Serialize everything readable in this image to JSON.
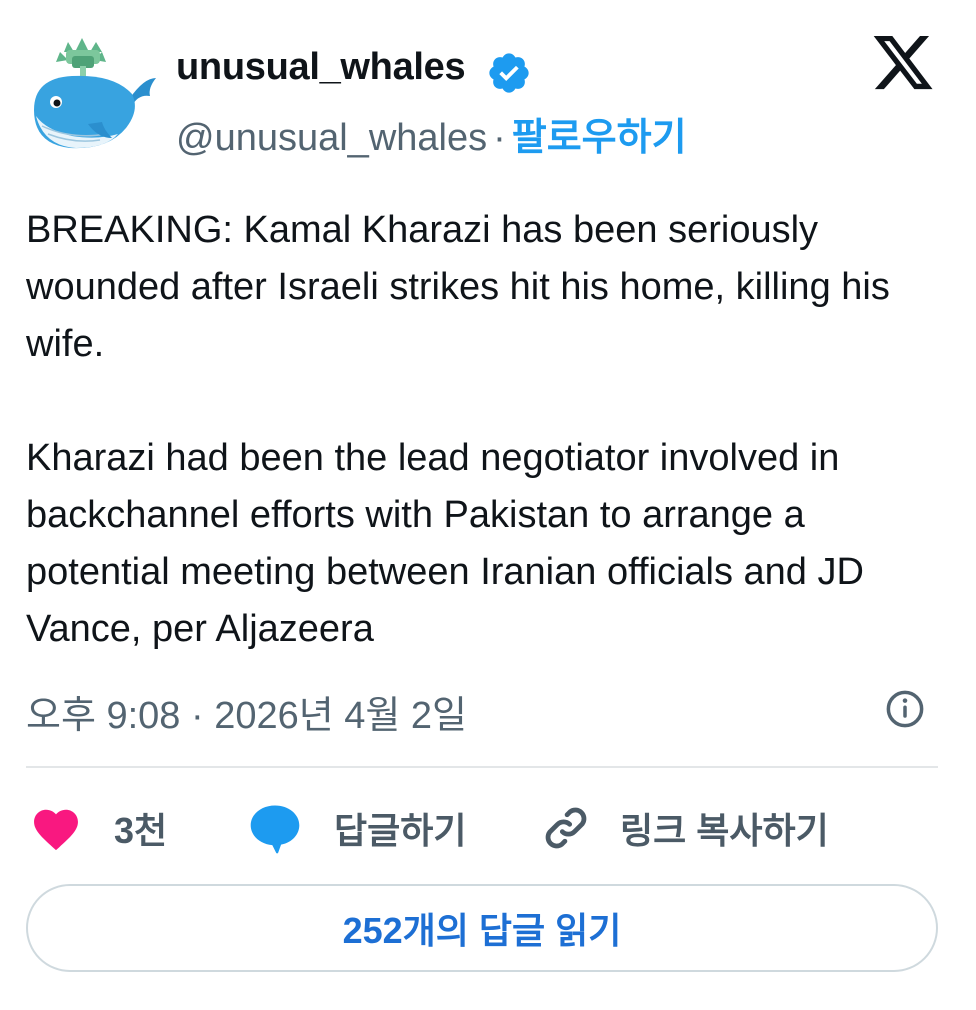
{
  "author": {
    "display_name": "unusual_whales",
    "handle": "@unusual_whales",
    "separator": "·",
    "follow_label": "팔로우하기",
    "verified": true
  },
  "tweet": {
    "paragraphs": [
      "BREAKING: Kamal Kharazi has been seriously wounded after Israeli strikes hit his home, killing his wife.",
      "Kharazi had been the lead negotiator involved in backchannel efforts with Pakistan to arrange a potential meeting between Iranian officials and JD Vance, per Aljazeera"
    ],
    "timestamp": "오후 9:08 · 2026년 4월 2일"
  },
  "actions": {
    "like_count": "3천",
    "reply_label": "답글하기",
    "copy_link_label": "링크 복사하기",
    "read_replies_label": "252개의 답글 읽기"
  },
  "icons": {
    "avatar": "whale-avatar",
    "verified": "verified-badge-icon",
    "logo": "x-logo-icon",
    "info": "info-icon",
    "like": "heart-icon",
    "reply": "speech-bubble-icon",
    "copy": "link-icon"
  },
  "colors": {
    "accent": "#1d9bf0",
    "heart": "#f91880",
    "text": "#0f1419",
    "muted": "#536471",
    "read_button_text": "#1d6fd4"
  }
}
